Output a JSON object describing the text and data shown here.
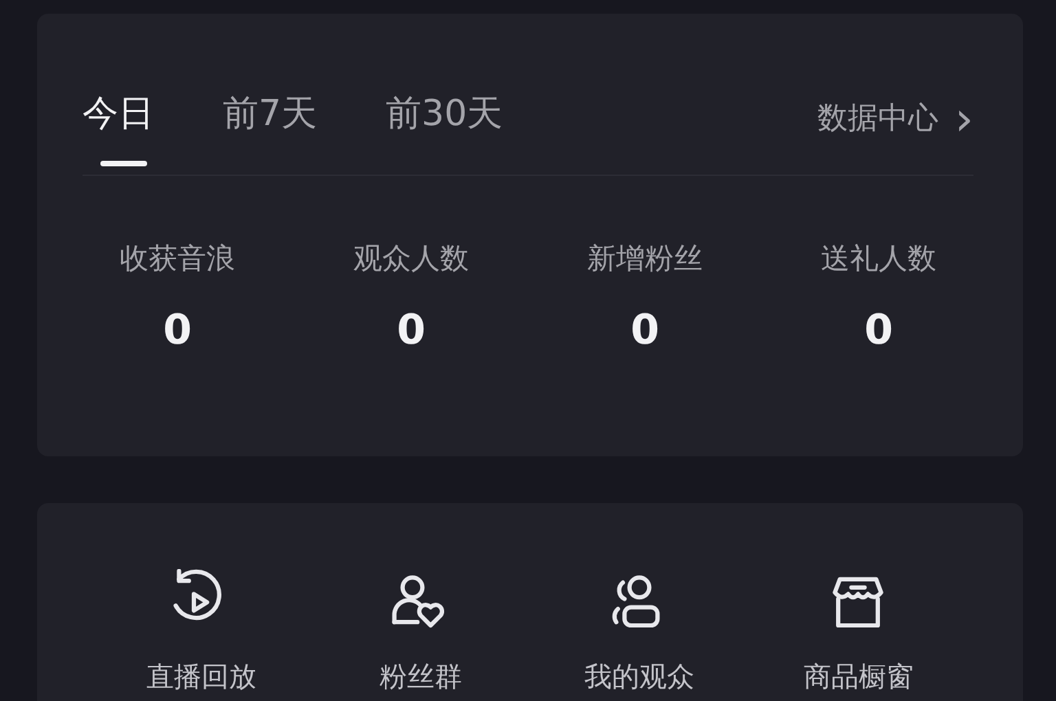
{
  "tabs": [
    {
      "label": "今日",
      "selected": true
    },
    {
      "label": "前7天",
      "selected": false
    },
    {
      "label": "前30天",
      "selected": false
    }
  ],
  "data_center_link": {
    "label": "数据中心",
    "chevron": "›"
  },
  "stats": [
    {
      "label": "收获音浪",
      "value": "0"
    },
    {
      "label": "观众人数",
      "value": "0"
    },
    {
      "label": "新增粉丝",
      "value": "0"
    },
    {
      "label": "送礼人数",
      "value": "0"
    }
  ],
  "tools": [
    {
      "kind": "replay",
      "label": "直播回放"
    },
    {
      "kind": "fans",
      "label": "粉丝群"
    },
    {
      "kind": "audience",
      "label": "我的观众"
    },
    {
      "kind": "shop",
      "label": "商品橱窗"
    }
  ]
}
